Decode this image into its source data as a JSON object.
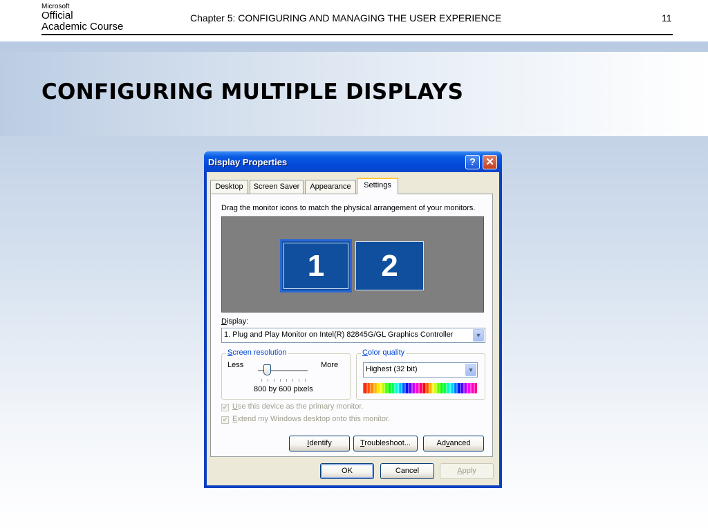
{
  "slide": {
    "logo": {
      "brand": "Microsoft",
      "line1": "Official",
      "line2": "Academic Course"
    },
    "chapter": "Chapter 5: CONFIGURING AND MANAGING THE USER EXPERIENCE",
    "page_number": "11",
    "title": "CONFIGURING MULTIPLE DISPLAYS"
  },
  "dialog": {
    "title": "Display Properties",
    "help_glyph": "?",
    "close_glyph": "✕",
    "tabs": [
      "Desktop",
      "Screen Saver",
      "Appearance",
      "Settings"
    ],
    "active_tab": "Settings",
    "instruction": "Drag the monitor icons to match the physical arrangement of your monitors.",
    "monitors": [
      "1",
      "2"
    ],
    "display_label_rest": "isplay:",
    "display_label_key": "D",
    "display_value": "1. Plug and Play Monitor on Intel(R) 82845G/GL Graphics Controller",
    "screen_resolution": {
      "label_key": "S",
      "label_rest": "creen resolution",
      "less": "Less",
      "more": "More",
      "value": "800 by 600 pixels"
    },
    "color_quality": {
      "label_key": "C",
      "label_rest": "olor quality",
      "value": "Highest (32 bit)"
    },
    "checkboxes": [
      {
        "key": "U",
        "rest": "se this device as the primary monitor.",
        "checked": true
      },
      {
        "key": "E",
        "rest": "xtend my Windows desktop onto this monitor.",
        "checked": true
      }
    ],
    "panel_buttons": {
      "identify_key": "I",
      "identify_rest": "dentify",
      "troubleshoot_key": "T",
      "troubleshoot_rest": "roubleshoot...",
      "advanced_pre": "Ad",
      "advanced_key": "v",
      "advanced_rest": "anced"
    },
    "footer_buttons": {
      "ok": "OK",
      "cancel": "Cancel",
      "apply_key": "A",
      "apply_rest": "pply"
    },
    "dropdown_glyph": "▼",
    "check_glyph": "✔"
  }
}
